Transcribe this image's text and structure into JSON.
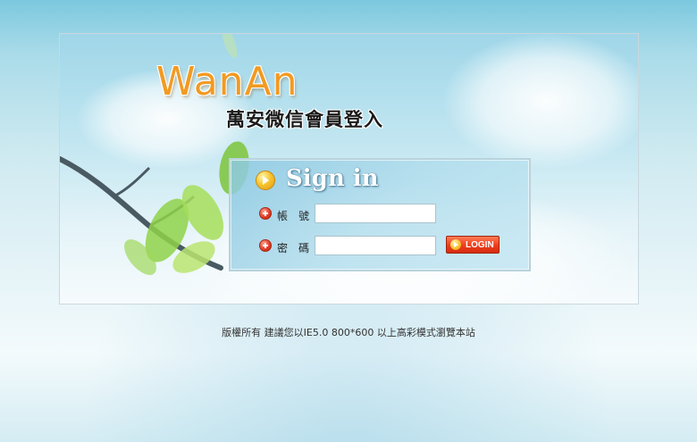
{
  "header": {
    "logo_text": "WanAn",
    "subtitle": "萬安微信會員登入"
  },
  "login": {
    "title": "Sign in",
    "account_label": "帳　號",
    "account_value": "",
    "password_label": "密　碼",
    "password_value": "",
    "button_label": "LOGIN"
  },
  "footer": {
    "text": "版權所有 建議您以IE5.0 800*600 以上高彩模式瀏覽本站"
  },
  "colors": {
    "logo": "#f29a22",
    "button": "#ee3d1c",
    "sky": "#9fd6e8"
  }
}
